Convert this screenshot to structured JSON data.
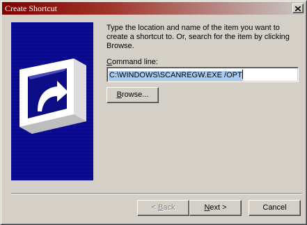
{
  "window": {
    "title": "Create Shortcut"
  },
  "description": "Type the location and name of the item you want to create a shortcut to. Or, search for the item by clicking Browse.",
  "command_line": {
    "label_prefix": "",
    "label_hotkey": "C",
    "label_rest": "ommand line:",
    "value": "C:\\WINDOWS\\SCANREGW.EXE /OPT"
  },
  "buttons": {
    "browse": {
      "hotkey": "B",
      "rest": "rowse..."
    },
    "back": {
      "prefix": "< ",
      "hotkey": "B",
      "rest": "ack",
      "enabled": false
    },
    "next": {
      "hotkey": "N",
      "rest": "ext >"
    },
    "cancel": {
      "label": "Cancel"
    }
  },
  "icons": {
    "close": "close-icon",
    "wizard_art": "shortcut-arrow-icon"
  },
  "colors": {
    "title_bar_start": "#800000",
    "title_bar_end": "#c8c8c8",
    "art_background": "#0c0c86",
    "selection": "#a6caf0",
    "face": "#d4d0c8"
  }
}
